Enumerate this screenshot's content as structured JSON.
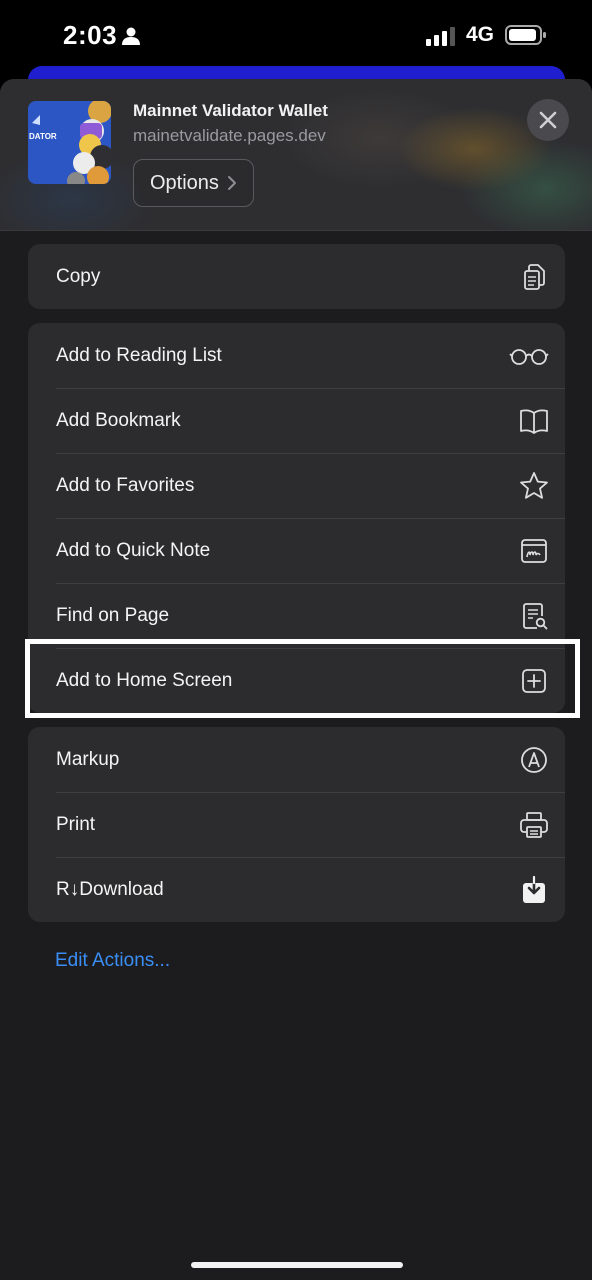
{
  "status_bar": {
    "time": "2:03",
    "network": "4G"
  },
  "share_sheet": {
    "site_title": "Mainnet Validator Wallet",
    "site_url": "mainetvalidate.pages.dev",
    "options_label": "Options",
    "thumbnail_text": "DATOR"
  },
  "groups": {
    "copy": [
      {
        "label": "Copy",
        "icon": "copy-icon"
      }
    ],
    "actions": [
      {
        "label": "Add to Reading List",
        "icon": "glasses-icon"
      },
      {
        "label": "Add Bookmark",
        "icon": "book-icon"
      },
      {
        "label": "Add to Favorites",
        "icon": "star-icon"
      },
      {
        "label": "Add to Quick Note",
        "icon": "quick-note-icon"
      },
      {
        "label": "Find on Page",
        "icon": "find-document-icon"
      },
      {
        "label": "Add to Home Screen",
        "icon": "plus-square-icon"
      }
    ],
    "extras": [
      {
        "label": "Markup",
        "icon": "markup-pen-icon"
      },
      {
        "label": "Print",
        "icon": "printer-icon"
      },
      {
        "label": "R↓Download",
        "icon": "download-icon"
      }
    ]
  },
  "edit_actions_label": "Edit Actions...",
  "colors": {
    "accent": "#3a8ef6",
    "sheet_background": "#1c1c1e",
    "row_background": "#2c2c2e",
    "highlight": "#ffffff"
  }
}
